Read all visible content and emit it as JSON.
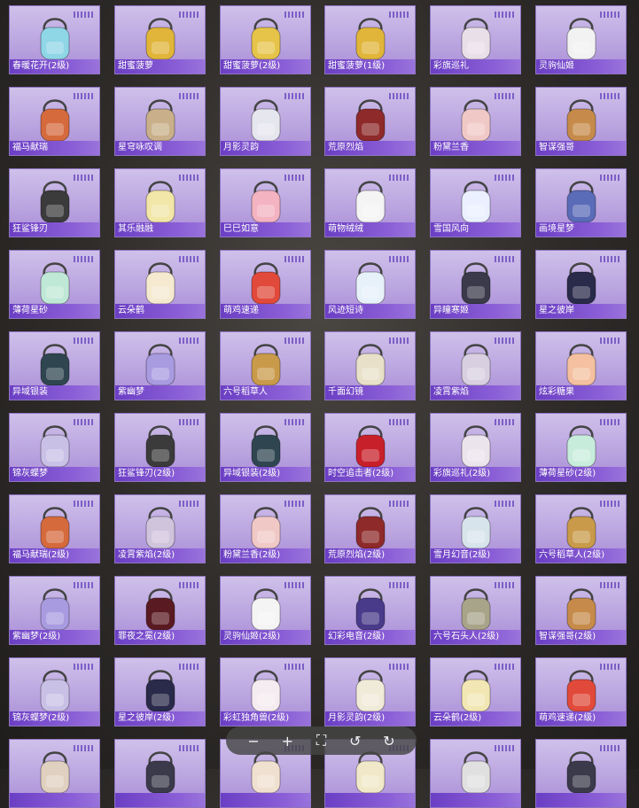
{
  "items": [
    {
      "label": "春暖花开(2级)",
      "color": "#8fd6e6"
    },
    {
      "label": "甜蜜菠萝",
      "color": "#e0b53a"
    },
    {
      "label": "甜蜜菠萝(2级)",
      "color": "#e6c44a"
    },
    {
      "label": "甜蜜菠萝(1级)",
      "color": "#e0b53a"
    },
    {
      "label": "彩旗巡礼",
      "color": "#e8dfe8"
    },
    {
      "label": "灵驹仙姬",
      "color": "#f2f2f2"
    },
    {
      "label": "福马献瑞",
      "color": "#d56a3c"
    },
    {
      "label": "星穹咏叹调",
      "color": "#c9b08a"
    },
    {
      "label": "月影灵韵",
      "color": "#e6e6ee"
    },
    {
      "label": "荒原烈焰",
      "color": "#8e2a2a"
    },
    {
      "label": "粉黛兰香",
      "color": "#f0c9c6"
    },
    {
      "label": "智谋强哥",
      "color": "#c68b4a"
    },
    {
      "label": "狂鲨锋刃",
      "color": "#3b3b3b"
    },
    {
      "label": "其乐融融",
      "color": "#f2e6a8"
    },
    {
      "label": "巳巳如意",
      "color": "#f3b3c0"
    },
    {
      "label": "萌物绒绒",
      "color": "#f4f4f4"
    },
    {
      "label": "雪国风向",
      "color": "#eaf0ff"
    },
    {
      "label": "画境星梦",
      "color": "#5a6bb8"
    },
    {
      "label": "薄荷星砂",
      "color": "#bfe8d6"
    },
    {
      "label": "云朵鹤",
      "color": "#f5ead0"
    },
    {
      "label": "萌鸡速递",
      "color": "#e14a3a"
    },
    {
      "label": "风迹短诗",
      "color": "#e7f1fa"
    },
    {
      "label": "异瞳寒姬",
      "color": "#3a3a4a"
    },
    {
      "label": "星之彼岸",
      "color": "#2a2a4a"
    },
    {
      "label": "异域银装",
      "color": "#2f4650"
    },
    {
      "label": "紫幽梦",
      "color": "#a89be0"
    },
    {
      "label": "六号稻草人",
      "color": "#c89a4a"
    },
    {
      "label": "千面幻镜",
      "color": "#e8e0c8"
    },
    {
      "label": "凌霄紫焰",
      "color": "#d8d0e0"
    },
    {
      "label": "炫彩糖果",
      "color": "#f4c0a0"
    },
    {
      "label": "锦灰蝶梦",
      "color": "#c9c0e6"
    },
    {
      "label": "狂鲨锋刃(2级)",
      "color": "#3b3b3b"
    },
    {
      "label": "异域银装(2级)",
      "color": "#2f4650"
    },
    {
      "label": "时空追击者(2级)",
      "color": "#c8202a"
    },
    {
      "label": "彩旗巡礼(2级)",
      "color": "#ece4ec"
    },
    {
      "label": "薄荷星砂(2级)",
      "color": "#c8ecdc"
    },
    {
      "label": "福马献瑞(2级)",
      "color": "#d56a3c"
    },
    {
      "label": "凌霄紫焰(2级)",
      "color": "#cfc4dc"
    },
    {
      "label": "粉黛兰香(2级)",
      "color": "#f0c9c6"
    },
    {
      "label": "荒原烈焰(2级)",
      "color": "#8e2a2a"
    },
    {
      "label": "雪月幻音(2级)",
      "color": "#d8e4ec"
    },
    {
      "label": "六号稻草人(2级)",
      "color": "#c89a4a"
    },
    {
      "label": "紫幽梦(2级)",
      "color": "#a89be0"
    },
    {
      "label": "罪夜之冕(2级)",
      "color": "#5a1a22"
    },
    {
      "label": "灵驹仙姬(2级)",
      "color": "#f4f4f4"
    },
    {
      "label": "幻彩电音(2级)",
      "color": "#4a3a8a"
    },
    {
      "label": "六号石头人(2级)",
      "color": "#a7a48a"
    },
    {
      "label": "智谋强哥(2级)",
      "color": "#c68b4a"
    },
    {
      "label": "锦灰蝶梦(2级)",
      "color": "#c9c0e6"
    },
    {
      "label": "星之彼岸(2级)",
      "color": "#2a2a4a"
    },
    {
      "label": "彩虹独角兽(2级)",
      "color": "#f4ecf0"
    },
    {
      "label": "月影灵韵(2级)",
      "color": "#f0ead8"
    },
    {
      "label": "云朵鹤(2级)",
      "color": "#f2e7b4"
    },
    {
      "label": "萌鸡速递(2级)",
      "color": "#e14a3a"
    },
    {
      "label": "",
      "color": "#e0d0c0"
    },
    {
      "label": "",
      "color": "#3a3a4a"
    },
    {
      "label": "",
      "color": "#f0e0d0"
    },
    {
      "label": "",
      "color": "#f0e8c8"
    },
    {
      "label": "",
      "color": "#e0e0e0"
    },
    {
      "label": "",
      "color": "#3a3a4a"
    }
  ],
  "toolbar": {
    "buttons": [
      {
        "name": "zoom-out-icon",
        "glyph": "−"
      },
      {
        "name": "zoom-in-icon",
        "glyph": "+"
      },
      {
        "name": "fullscreen-icon",
        "glyph": "⛶"
      },
      {
        "name": "rotate-left-icon",
        "glyph": "↺"
      },
      {
        "name": "rotate-right-icon",
        "glyph": "↻"
      }
    ]
  }
}
